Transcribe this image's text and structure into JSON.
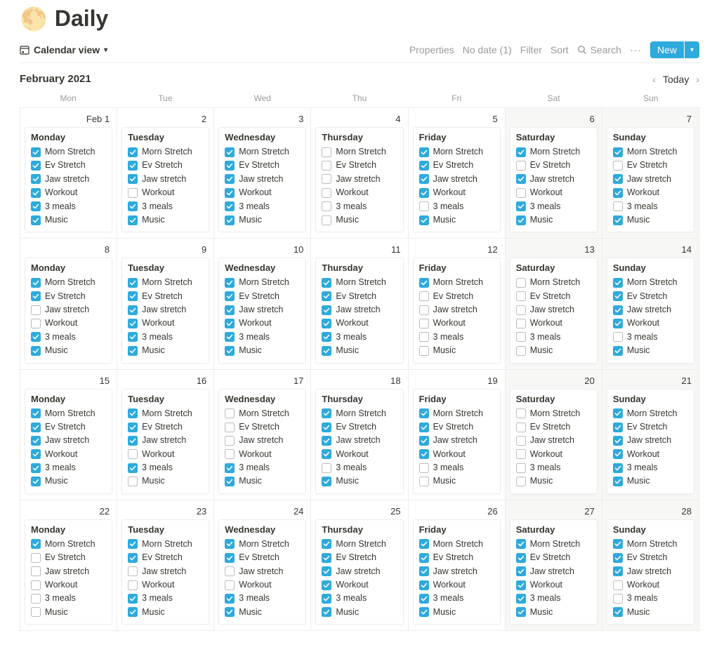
{
  "header": {
    "emoji": "🌕",
    "title": "Daily"
  },
  "toolbar": {
    "view_label": "Calendar view",
    "properties": "Properties",
    "no_date": "No date (1)",
    "filter": "Filter",
    "sort": "Sort",
    "search": "Search",
    "new_label": "New"
  },
  "month": {
    "label": "February 2021",
    "today": "Today"
  },
  "dow": [
    "Mon",
    "Tue",
    "Wed",
    "Thu",
    "Fri",
    "Sat",
    "Sun"
  ],
  "task_labels": [
    "Morn Stretch",
    "Ev Stretch",
    "Jaw stretch",
    "Workout",
    "3 meals",
    "Music"
  ],
  "days": [
    {
      "num": "Feb 1",
      "weekend": false,
      "title": "Monday",
      "checks": [
        true,
        true,
        true,
        true,
        true,
        true
      ]
    },
    {
      "num": "2",
      "weekend": false,
      "title": "Tuesday",
      "checks": [
        true,
        true,
        true,
        false,
        true,
        true
      ]
    },
    {
      "num": "3",
      "weekend": false,
      "title": "Wednesday",
      "checks": [
        true,
        true,
        true,
        true,
        true,
        true
      ]
    },
    {
      "num": "4",
      "weekend": false,
      "title": "Thursday",
      "checks": [
        false,
        false,
        false,
        false,
        false,
        false
      ]
    },
    {
      "num": "5",
      "weekend": false,
      "title": "Friday",
      "checks": [
        true,
        true,
        true,
        true,
        false,
        true
      ]
    },
    {
      "num": "6",
      "weekend": true,
      "title": "Saturday",
      "checks": [
        true,
        false,
        true,
        false,
        true,
        true
      ]
    },
    {
      "num": "7",
      "weekend": true,
      "title": "Sunday",
      "checks": [
        true,
        false,
        true,
        true,
        false,
        true
      ]
    },
    {
      "num": "8",
      "weekend": false,
      "title": "Monday",
      "checks": [
        true,
        true,
        false,
        false,
        true,
        true
      ]
    },
    {
      "num": "9",
      "weekend": false,
      "title": "Tuesday",
      "checks": [
        true,
        true,
        true,
        true,
        true,
        true
      ]
    },
    {
      "num": "10",
      "weekend": false,
      "title": "Wednesday",
      "checks": [
        true,
        true,
        true,
        true,
        true,
        true
      ]
    },
    {
      "num": "11",
      "weekend": false,
      "title": "Thursday",
      "checks": [
        true,
        true,
        true,
        true,
        true,
        true
      ]
    },
    {
      "num": "12",
      "weekend": false,
      "title": "Friday",
      "checks": [
        true,
        false,
        false,
        false,
        false,
        false
      ]
    },
    {
      "num": "13",
      "weekend": true,
      "title": "Saturday",
      "checks": [
        false,
        false,
        false,
        false,
        false,
        false
      ]
    },
    {
      "num": "14",
      "weekend": true,
      "title": "Sunday",
      "checks": [
        true,
        true,
        true,
        true,
        false,
        true
      ]
    },
    {
      "num": "15",
      "weekend": false,
      "title": "Monday",
      "checks": [
        true,
        true,
        true,
        true,
        true,
        true
      ]
    },
    {
      "num": "16",
      "weekend": false,
      "title": "Tuesday",
      "checks": [
        true,
        true,
        true,
        false,
        true,
        false
      ]
    },
    {
      "num": "17",
      "weekend": false,
      "title": "Wednesday",
      "checks": [
        false,
        false,
        false,
        false,
        true,
        true
      ]
    },
    {
      "num": "18",
      "weekend": false,
      "title": "Thursday",
      "checks": [
        true,
        true,
        true,
        true,
        false,
        true
      ]
    },
    {
      "num": "19",
      "weekend": false,
      "title": "Friday",
      "checks": [
        true,
        true,
        true,
        true,
        false,
        false
      ]
    },
    {
      "num": "20",
      "weekend": true,
      "title": "Saturday",
      "checks": [
        false,
        false,
        false,
        false,
        false,
        false
      ]
    },
    {
      "num": "21",
      "weekend": true,
      "title": "Sunday",
      "checks": [
        true,
        true,
        true,
        true,
        true,
        true
      ]
    },
    {
      "num": "22",
      "weekend": false,
      "title": "Monday",
      "checks": [
        true,
        false,
        false,
        false,
        false,
        false
      ]
    },
    {
      "num": "23",
      "weekend": false,
      "title": "Tuesday",
      "checks": [
        true,
        true,
        false,
        false,
        true,
        true
      ]
    },
    {
      "num": "24",
      "weekend": false,
      "title": "Wednesday",
      "checks": [
        true,
        true,
        false,
        false,
        true,
        true
      ]
    },
    {
      "num": "25",
      "weekend": false,
      "title": "Thursday",
      "checks": [
        true,
        true,
        true,
        true,
        true,
        true
      ]
    },
    {
      "num": "26",
      "weekend": false,
      "title": "Friday",
      "checks": [
        true,
        true,
        true,
        true,
        true,
        true
      ]
    },
    {
      "num": "27",
      "weekend": true,
      "title": "Saturday",
      "checks": [
        true,
        true,
        true,
        true,
        true,
        true
      ]
    },
    {
      "num": "28",
      "weekend": true,
      "title": "Sunday",
      "checks": [
        true,
        true,
        true,
        false,
        false,
        true
      ]
    }
  ]
}
